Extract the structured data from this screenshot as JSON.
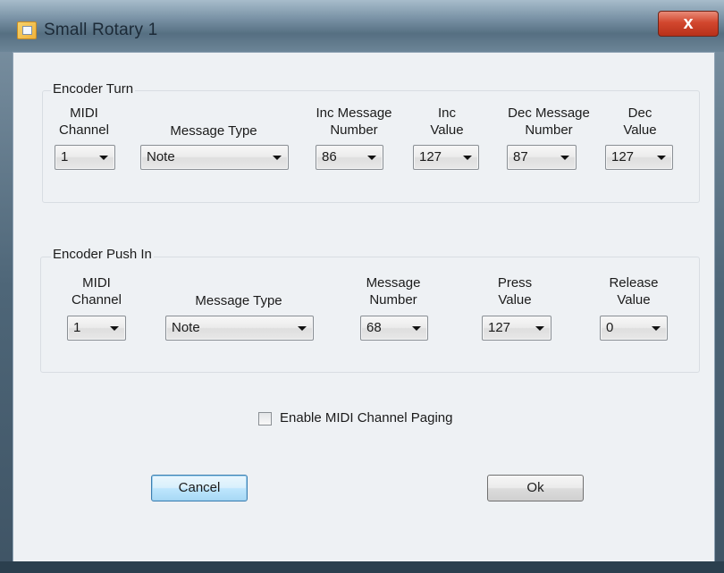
{
  "window": {
    "title": "Small Rotary 1",
    "close_glyph": "x"
  },
  "encoder_turn": {
    "group_label": "Encoder Turn",
    "columns": [
      {
        "label_line1": "MIDI",
        "label_line2": "Channel",
        "value": "1"
      },
      {
        "label_line1": "Message Type",
        "label_line2": "",
        "value": "Note"
      },
      {
        "label_line1": "Inc Message",
        "label_line2": "Number",
        "value": "86"
      },
      {
        "label_line1": "Inc",
        "label_line2": "Value",
        "value": "127"
      },
      {
        "label_line1": "Dec Message",
        "label_line2": "Number",
        "value": "87"
      },
      {
        "label_line1": "Dec",
        "label_line2": "Value",
        "value": "127"
      }
    ]
  },
  "encoder_push": {
    "group_label": "Encoder Push In",
    "columns": [
      {
        "label_line1": "MIDI",
        "label_line2": "Channel",
        "value": "1"
      },
      {
        "label_line1": "Message Type",
        "label_line2": "",
        "value": "Note"
      },
      {
        "label_line1": "Message",
        "label_line2": "Number",
        "value": "68"
      },
      {
        "label_line1": "Press",
        "label_line2": "Value",
        "value": "127"
      },
      {
        "label_line1": "Release",
        "label_line2": "Value",
        "value": "0"
      }
    ]
  },
  "paging": {
    "label": "Enable MIDI Channel Paging",
    "checked": false
  },
  "buttons": {
    "cancel": "Cancel",
    "ok": "Ok"
  }
}
